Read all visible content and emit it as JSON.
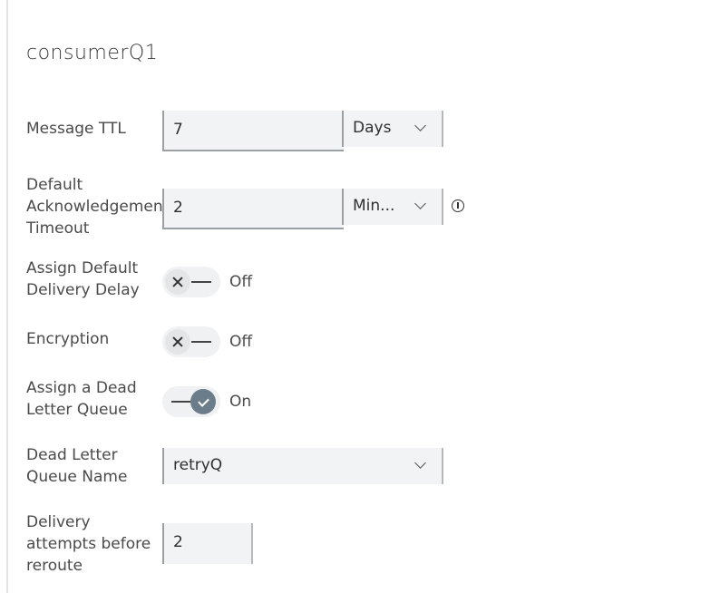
{
  "title": "consumerQ1",
  "ttl": {
    "label": "Message TTL",
    "value": "7",
    "unit": "Days"
  },
  "ack": {
    "label_lines": [
      "Default",
      "Acknowledgement",
      "Timeout"
    ],
    "value": "2",
    "unit": "Min..."
  },
  "delay": {
    "label_lines": [
      "Assign Default",
      "Delivery Delay"
    ],
    "state": "Off"
  },
  "encryption": {
    "label": "Encryption",
    "state": "Off"
  },
  "dlq": {
    "label_lines": [
      "Assign a Dead",
      "Letter Queue"
    ],
    "state": "On"
  },
  "dlq_name": {
    "label_lines": [
      "Dead Letter",
      "Queue Name"
    ],
    "value": "retryQ"
  },
  "attempts": {
    "label_lines": [
      "Delivery",
      "attempts before",
      "reroute"
    ],
    "value": "2"
  },
  "colors": {
    "toggle_on": "#6b7c8b",
    "field_bg": "#f2f3f4",
    "field_border": "#9aa0a6"
  }
}
